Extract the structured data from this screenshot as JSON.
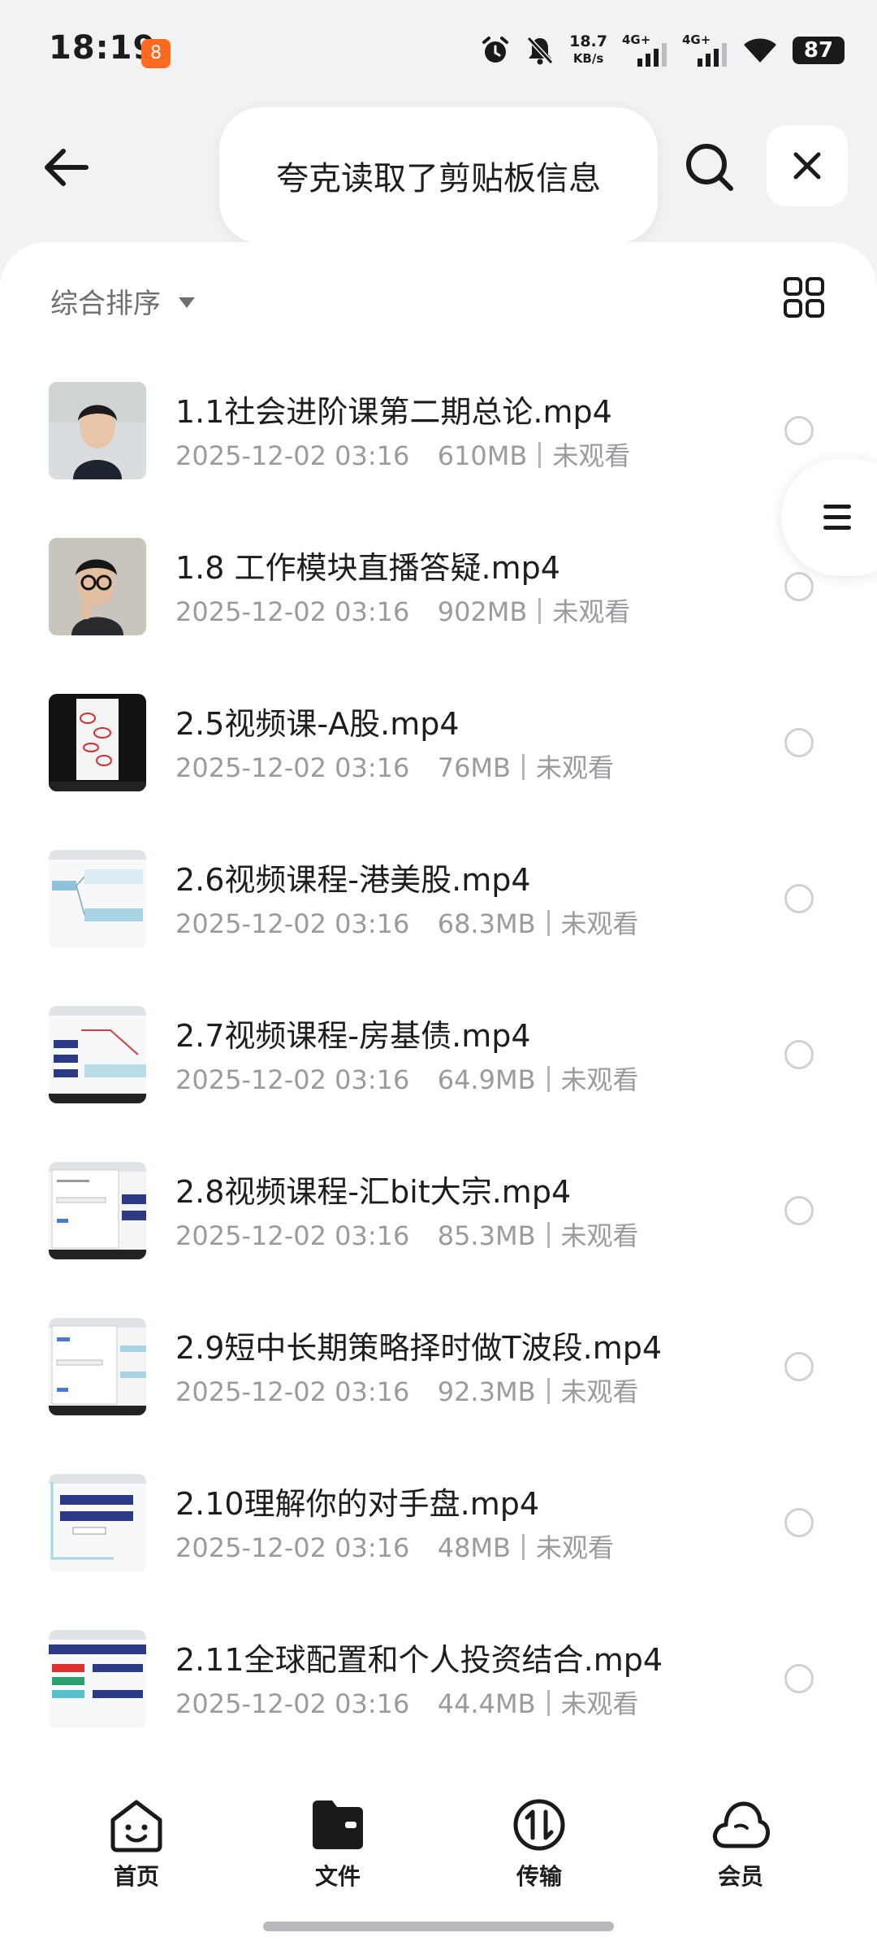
{
  "status_bar": {
    "time": "18:19",
    "app_badge": "8",
    "net_speed_value": "18.7",
    "net_speed_unit": "KB/s",
    "sim1": "4G+",
    "sim2": "4G+",
    "battery": "87"
  },
  "top_bar": {
    "toast": "夸克读取了剪贴板信息"
  },
  "toolbar": {
    "sort_label": "综合排序"
  },
  "files": [
    {
      "name": "1.1社会进阶课第二期总论.mp4",
      "date": "2025-12-02 03:16",
      "size": "610MB",
      "status": "未观看",
      "thumb": "person"
    },
    {
      "name": "1.8 工作模块直播答疑.mp4",
      "date": "2025-12-02 03:16",
      "size": "902MB",
      "status": "未观看",
      "thumb": "person-glasses"
    },
    {
      "name": "2.5视频课-A股.mp4",
      "date": "2025-12-02 03:16",
      "size": "76MB",
      "status": "未观看",
      "thumb": "dark-doc"
    },
    {
      "name": "2.6视频课程-港美股.mp4",
      "date": "2025-12-02 03:16",
      "size": "68.3MB",
      "status": "未观看",
      "thumb": "slide-blue"
    },
    {
      "name": "2.7视频课程-房基债.mp4",
      "date": "2025-12-02 03:16",
      "size": "64.9MB",
      "status": "未观看",
      "thumb": "slide-navy"
    },
    {
      "name": "2.8视频课程-汇bit大宗.mp4",
      "date": "2025-12-02 03:16",
      "size": "85.3MB",
      "status": "未观看",
      "thumb": "dialog"
    },
    {
      "name": "2.9短中长期策略择时做T波段.mp4",
      "date": "2025-12-02 03:16",
      "size": "92.3MB",
      "status": "未观看",
      "thumb": "dialog"
    },
    {
      "name": "2.10理解你的对手盘.mp4",
      "date": "2025-12-02 03:16",
      "size": "48MB",
      "status": "未观看",
      "thumb": "slide-navy"
    },
    {
      "name": "2.11全球配置和个人投资结合.mp4",
      "date": "2025-12-02 03:16",
      "size": "44.4MB",
      "status": "未观看",
      "thumb": "slide-mixed"
    }
  ],
  "bottom_nav": [
    {
      "label": "首页",
      "icon": "home-face-icon"
    },
    {
      "label": "文件",
      "icon": "folder-icon"
    },
    {
      "label": "传输",
      "icon": "transfer-icon"
    },
    {
      "label": "会员",
      "icon": "cloud-icon"
    }
  ],
  "colors": {
    "accent_badge": "#ff6a1f",
    "text_primary": "#1d1d1f",
    "text_secondary": "#9a9aa0"
  }
}
